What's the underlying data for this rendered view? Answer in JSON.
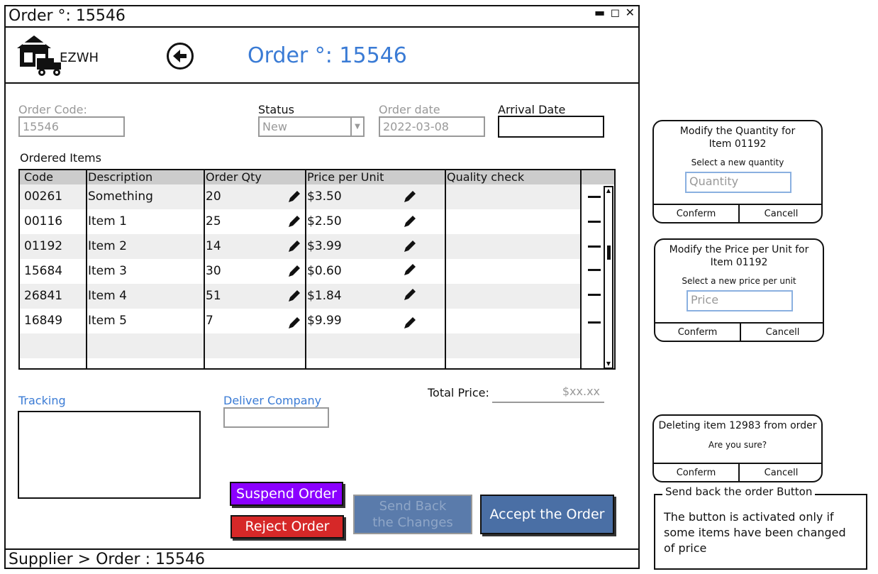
{
  "window": {
    "title": "Order °: 15546",
    "controls": "▬ ◻ ✕"
  },
  "header": {
    "brand": "EZWH",
    "page_title": "Order °: 15546"
  },
  "form": {
    "order_code_label": "Order Code:",
    "order_code_value": "15546",
    "status_label": "Status",
    "status_value": "New",
    "order_date_label": "Order date",
    "order_date_value": "2022-03-08",
    "arrival_date_label": "Arrival Date",
    "arrival_date_value": ""
  },
  "ordered_items": {
    "title": "Ordered Items",
    "columns": [
      "Code",
      "Description",
      "Order Qty",
      "Price per Unit",
      "Quality check"
    ],
    "rows": [
      {
        "code": "00261",
        "description": "Something",
        "qty": "20",
        "price": "$3.50"
      },
      {
        "code": "00116",
        "description": "Item 1",
        "qty": "25",
        "price": "$2.50"
      },
      {
        "code": "01192",
        "description": "Item 2",
        "qty": "14",
        "price": "$3.99"
      },
      {
        "code": "15684",
        "description": "Item 3",
        "qty": "30",
        "price": "$0.60"
      },
      {
        "code": "26841",
        "description": "Item 4",
        "qty": "51",
        "price": "$1.84"
      },
      {
        "code": "16849",
        "description": "Item 5",
        "qty": "7",
        "price": "$9.99"
      }
    ]
  },
  "tracking": {
    "label": "Tracking",
    "value": ""
  },
  "deliver": {
    "label": "Deliver Company",
    "value": ""
  },
  "total": {
    "label": "Total Price:",
    "value": "$xx.xx"
  },
  "actions": {
    "suspend": "Suspend Order",
    "reject": "Reject Order",
    "send_back_line1": "Send Back",
    "send_back_line2": "the Changes",
    "accept": "Accept the Order"
  },
  "footer": {
    "breadcrumb": "Supplier > Order : 15546"
  },
  "modal_qty": {
    "title_line1": "Modify the Quantity for",
    "title_line2": "Item 01192",
    "prompt": "Select a new quantity",
    "placeholder": "Quantity",
    "confirm": "Conferm",
    "cancel": "Cancell"
  },
  "modal_price": {
    "title_line1": "Modify the Price per Unit for",
    "title_line2": "Item 01192",
    "prompt": "Select a new price per unit",
    "placeholder": "Price",
    "confirm": "Conferm",
    "cancel": "Cancell"
  },
  "modal_delete": {
    "title": "Deleting item 12983 from order",
    "prompt": "Are you sure?",
    "confirm": "Conferm",
    "cancel": "Cancell"
  },
  "note": {
    "title": "Send back the order Button",
    "text": "The button is activated only if some items have been changed of price"
  },
  "colors": {
    "accent": "#3a7bd5",
    "suspend": "#8b00ff",
    "reject": "#d62828",
    "disabled": "#5a7bab",
    "accept": "#4a6fa5"
  },
  "icons": {
    "logo": "warehouse-truck-icon",
    "back": "arrow-left-circle-icon",
    "edit": "pencil-icon",
    "delete": "minus-icon"
  }
}
